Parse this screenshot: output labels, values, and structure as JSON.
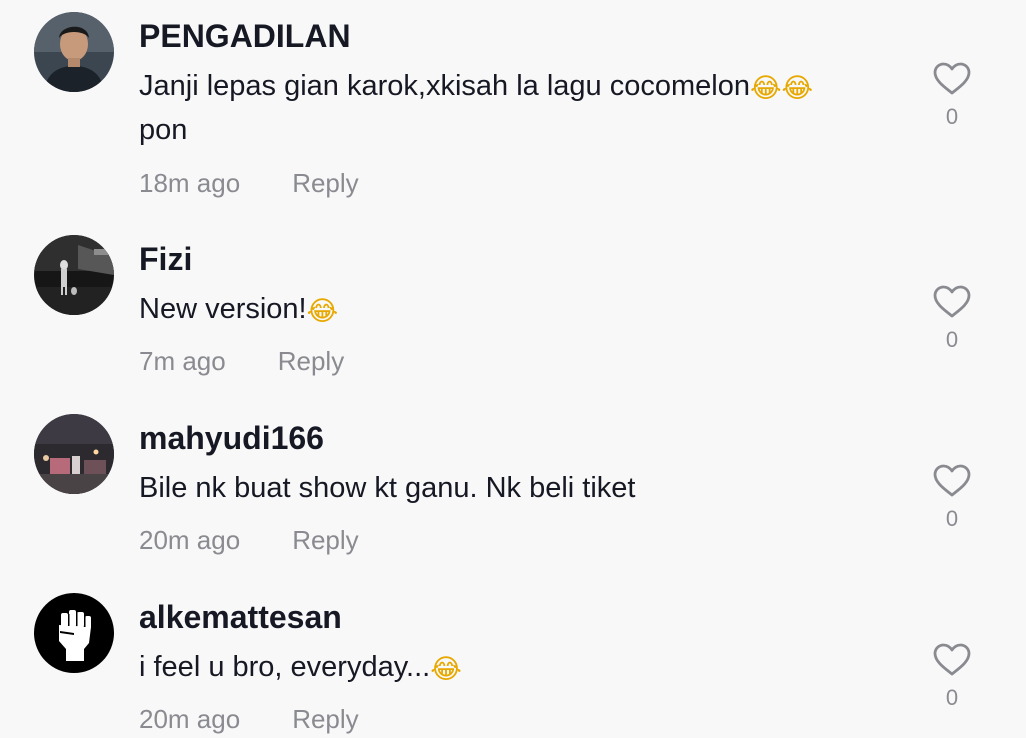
{
  "comments": [
    {
      "username": "PENGADILAN",
      "text": "Janji lepas gian karok,xkisah la lagu cocomelon",
      "text_emoji": "😂😂",
      "text_cont": "pon",
      "time": "18m ago",
      "reply_label": "Reply",
      "likes": "0",
      "avatar_icon": "man-portrait-avatar"
    },
    {
      "username": "Fizi",
      "text": "New version!",
      "text_emoji": "😂",
      "time": "7m ago",
      "reply_label": "Reply",
      "likes": "0",
      "avatar_icon": "dark-street-photo-avatar"
    },
    {
      "username": "mahyudi166",
      "text": "Bile nk buat show kt ganu. Nk beli tiket",
      "time": "20m ago",
      "reply_label": "Reply",
      "likes": "0",
      "avatar_icon": "night-city-photo-avatar"
    },
    {
      "username": "alkemattesan",
      "text": "i feel u bro, everyday...",
      "text_emoji": "😂",
      "time": "20m ago",
      "reply_label": "Reply",
      "likes": "0",
      "avatar_icon": "raised-fist-avatar"
    }
  ],
  "colors": {
    "background": "#f8f8f8",
    "username": "#161823",
    "secondary": "#8a8b91",
    "emoji": "#e7a800"
  }
}
